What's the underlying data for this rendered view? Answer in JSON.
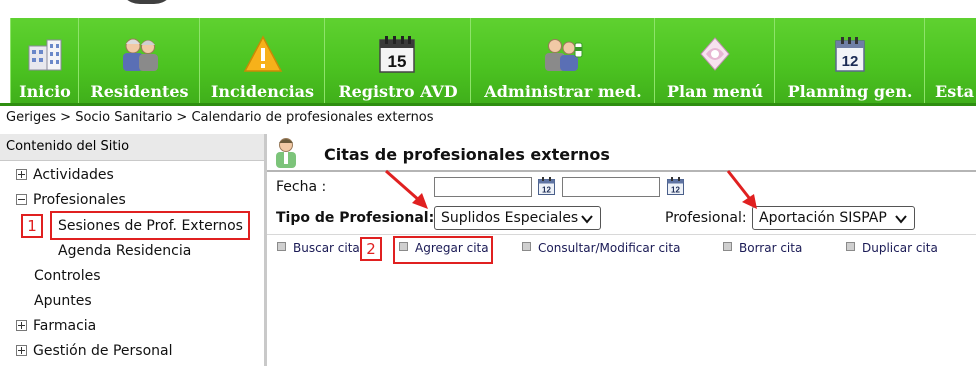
{
  "nav": {
    "items": [
      {
        "label": "Inicio",
        "icon": "hospital-building-icon"
      },
      {
        "label": "Residentes",
        "icon": "elderly-people-icon"
      },
      {
        "label": "Incidencias",
        "icon": "warning-triangle-icon"
      },
      {
        "label": "Registro AVD",
        "icon": "calendar-15-icon"
      },
      {
        "label": "Administrar med.",
        "icon": "nurse-medication-icon"
      },
      {
        "label": "Plan menú",
        "icon": "food-menu-icon"
      },
      {
        "label": "Planning gen.",
        "icon": "calendar-12-icon"
      },
      {
        "label": "Esta",
        "icon": "statistics-icon"
      }
    ],
    "colors": {
      "bar": "#4cc321",
      "label": "#ffffff"
    }
  },
  "breadcrumb": {
    "text": "Geriges > Socio Sanitario > Calendario de profesionales externos"
  },
  "sidebar": {
    "header": "Contenido del Sitio",
    "items": [
      {
        "label": "Actividades",
        "expander": "plus"
      },
      {
        "label": "Profesionales",
        "expander": "minus"
      },
      {
        "label": "Sesiones de Prof. Externos",
        "expander": "none"
      },
      {
        "label": "Agenda Residencia",
        "expander": "none"
      },
      {
        "label": "Controles",
        "expander": "none"
      },
      {
        "label": "Apuntes",
        "expander": "none"
      },
      {
        "label": "Farmacia",
        "expander": "plus"
      },
      {
        "label": "Gestión de Personal",
        "expander": "plus"
      }
    ],
    "annotation_1": "1"
  },
  "main": {
    "title": "Citas de profesionales externos",
    "fecha_label": "Fecha :",
    "fecha_from": "",
    "fecha_to": "",
    "tipo_label": "Tipo de Profesional:",
    "tipo_value": "Suplidos Especiales",
    "profesional_label": "Profesional:",
    "profesional_value": "Aportación SISPAP",
    "annotation_2": "2",
    "actions": [
      {
        "label": "Buscar citas"
      },
      {
        "label": "Agregar cita"
      },
      {
        "label": "Consultar/Modificar cita"
      },
      {
        "label": "Borrar cita"
      },
      {
        "label": "Duplicar cita"
      }
    ],
    "calendar_day": "12"
  },
  "colors": {
    "annotation": "#e02020",
    "action_text": "#1a1a55"
  }
}
